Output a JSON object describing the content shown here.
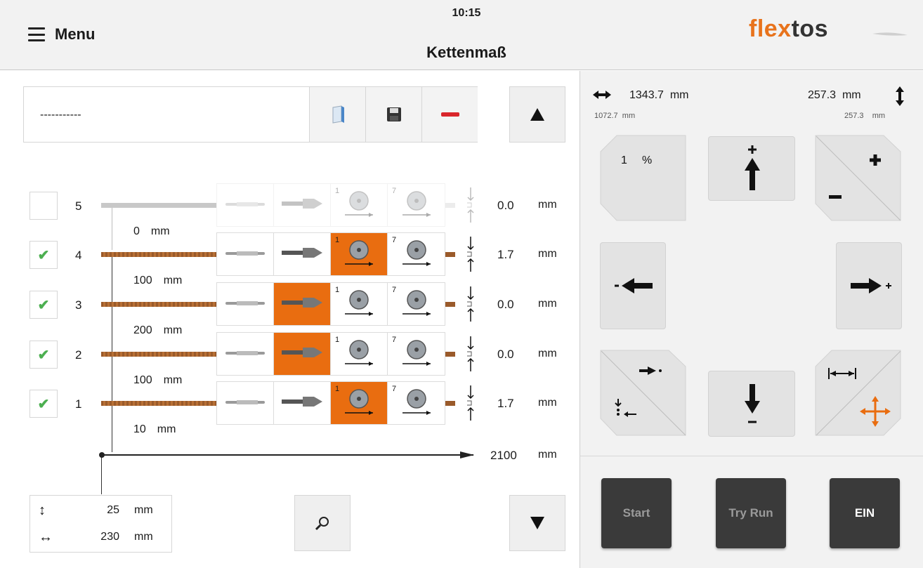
{
  "header": {
    "menu_label": "Menu",
    "time": "10:15",
    "title": "Kettenmaß",
    "logo_a": "flex",
    "logo_b": "tos"
  },
  "program": {
    "name": "-----------"
  },
  "rows": [
    {
      "num": "5",
      "checked": false,
      "active_tool": -1,
      "value": "0.0",
      "unit": "mm",
      "tool_idx_a": "1",
      "tool_idx_b": "7"
    },
    {
      "num": "4",
      "checked": true,
      "active_tool": 2,
      "value": "1.7",
      "unit": "mm",
      "tool_idx_a": "1",
      "tool_idx_b": "7"
    },
    {
      "num": "3",
      "checked": true,
      "active_tool": 1,
      "value": "0.0",
      "unit": "mm",
      "tool_idx_a": "1",
      "tool_idx_b": "7"
    },
    {
      "num": "2",
      "checked": true,
      "active_tool": 1,
      "value": "0.0",
      "unit": "mm",
      "tool_idx_a": "1",
      "tool_idx_b": "7"
    },
    {
      "num": "1",
      "checked": true,
      "active_tool": 2,
      "value": "1.7",
      "unit": "mm",
      "tool_idx_a": "1",
      "tool_idx_b": "7"
    }
  ],
  "gaps": [
    {
      "value": "0",
      "unit": "mm"
    },
    {
      "value": "100",
      "unit": "mm"
    },
    {
      "value": "200",
      "unit": "mm"
    },
    {
      "value": "100",
      "unit": "mm"
    },
    {
      "value": "10",
      "unit": "mm"
    }
  ],
  "axis": {
    "value": "2100",
    "unit": "mm"
  },
  "dims": {
    "height": "25",
    "width": "230",
    "unit": "mm"
  },
  "position": {
    "x_value": "1343.7",
    "x_unit": "mm",
    "x_sub": "1072.7",
    "x_sub_unit": "mm",
    "y_value": "257.3",
    "y_unit": "mm",
    "y_sub": "257.3",
    "y_sub_unit": "mm"
  },
  "jog": {
    "step": "1",
    "step_unit": "%"
  },
  "actions": {
    "start": "Start",
    "try_run": "Try Run",
    "on": "EIN"
  },
  "colors": {
    "accent": "#e96d10",
    "check": "#4caf50",
    "rope": "#9a5a2a"
  },
  "icons": [
    "menu-icon",
    "document-icon",
    "save-icon",
    "remove-icon",
    "arrow-up-icon",
    "arrow-down-icon",
    "magnifier-icon",
    "checkmark-icon",
    "cutter-icon",
    "drill-icon",
    "saw-blade-icon"
  ]
}
